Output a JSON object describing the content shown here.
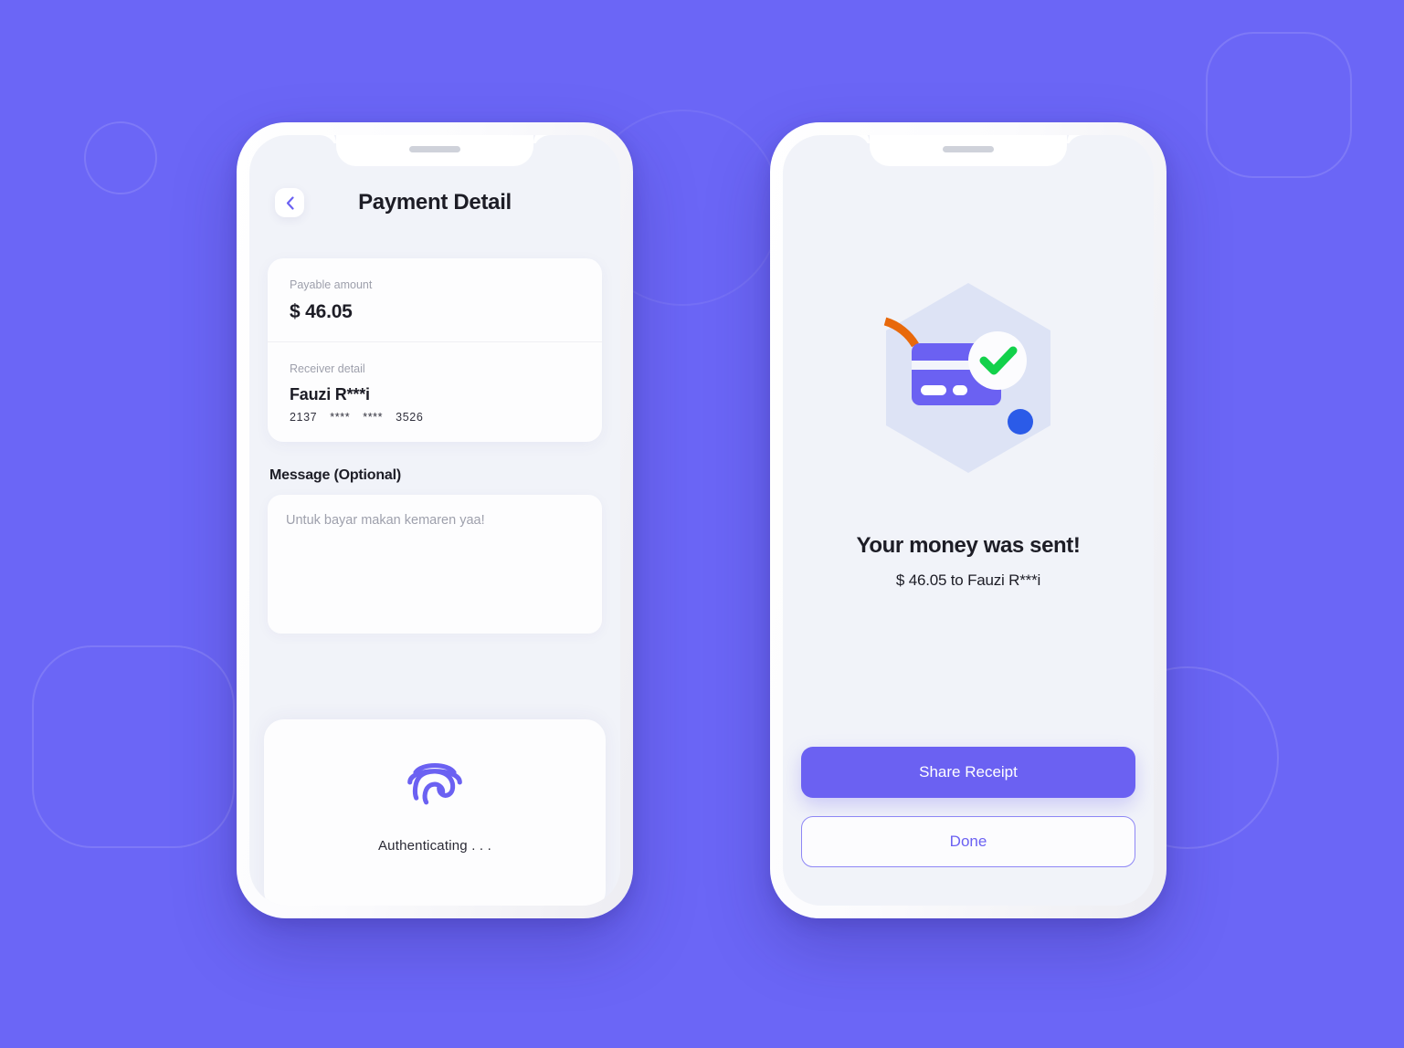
{
  "theme": {
    "background": "#6B66F6",
    "accent": "#6B61F2",
    "screen_bg": "#F1F3F9",
    "success_green": "#12D14A",
    "orange": "#E8690B",
    "blue_dot": "#2B5BE8",
    "card_purple": "#6B61F2",
    "hex_backdrop": "#DDE3F5"
  },
  "left_phone": {
    "header": {
      "back_icon": "chevron-left-icon",
      "title": "Payment Detail"
    },
    "detail_card": {
      "amount_label": "Payable amount",
      "amount_value": "$ 46.05",
      "receiver_label": "Receiver detail",
      "receiver_name": "Fauzi R***i",
      "card_number_parts": [
        "2137",
        "****",
        "****",
        "3526"
      ]
    },
    "message": {
      "label": "Message (Optional)",
      "value": "",
      "placeholder": "Untuk bayar makan kemaren yaa!"
    },
    "auth": {
      "icon": "fingerprint-icon",
      "status": "Authenticating . . ."
    }
  },
  "right_phone": {
    "illustration": {
      "backdrop": "hexagon-shape",
      "card_icon": "credit-card-icon",
      "badge_icon": "check-circle-icon",
      "accent_arc": "orange-arc",
      "accent_dot": "blue-dot"
    },
    "title": "Your money was sent!",
    "subtitle": "$ 46.05 to Fauzi R***i",
    "primary_button": "Share Receipt",
    "secondary_button": "Done"
  }
}
